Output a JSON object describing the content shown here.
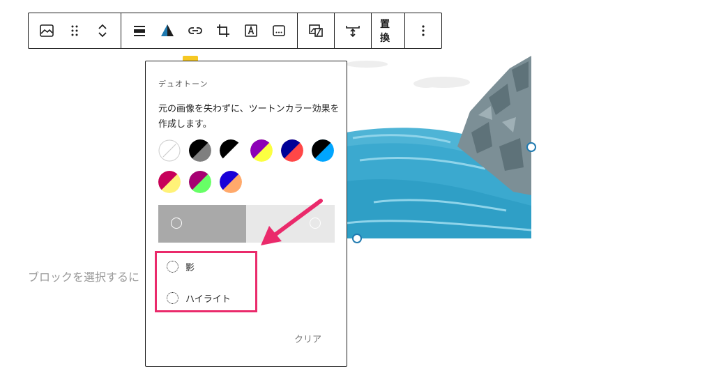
{
  "toolbar": {
    "replace_label": "置換"
  },
  "popover": {
    "title": "デュオトーン",
    "description": "元の画像を失わずに、ツートンカラー効果を作成します。",
    "swatches": [
      {
        "name": "none",
        "colors": [
          "#ffffff",
          "#ffffff"
        ]
      },
      {
        "name": "dark-grayscale",
        "colors": [
          "#000000",
          "#7f7f7f"
        ]
      },
      {
        "name": "grayscale",
        "colors": [
          "#000000",
          "#ffffff"
        ]
      },
      {
        "name": "purple-yellow",
        "colors": [
          "#8c00b7",
          "#fcff41"
        ]
      },
      {
        "name": "blue-red",
        "colors": [
          "#000097",
          "#ff4747"
        ]
      },
      {
        "name": "midnight",
        "colors": [
          "#000000",
          "#00a5ff"
        ]
      },
      {
        "name": "magenta-yellow",
        "colors": [
          "#c7005a",
          "#fff278"
        ]
      },
      {
        "name": "purple-green",
        "colors": [
          "#a60072",
          "#67ff66"
        ]
      },
      {
        "name": "blue-orange",
        "colors": [
          "#1900d8",
          "#ffa96b"
        ]
      }
    ],
    "shadow_label": "影",
    "highlight_label": "ハイライト",
    "clear_label": "クリア"
  },
  "hint_text": "ブロックを選択するに",
  "colors": {
    "accent": "#ea2a6b",
    "handle": "#1f7ab0"
  }
}
